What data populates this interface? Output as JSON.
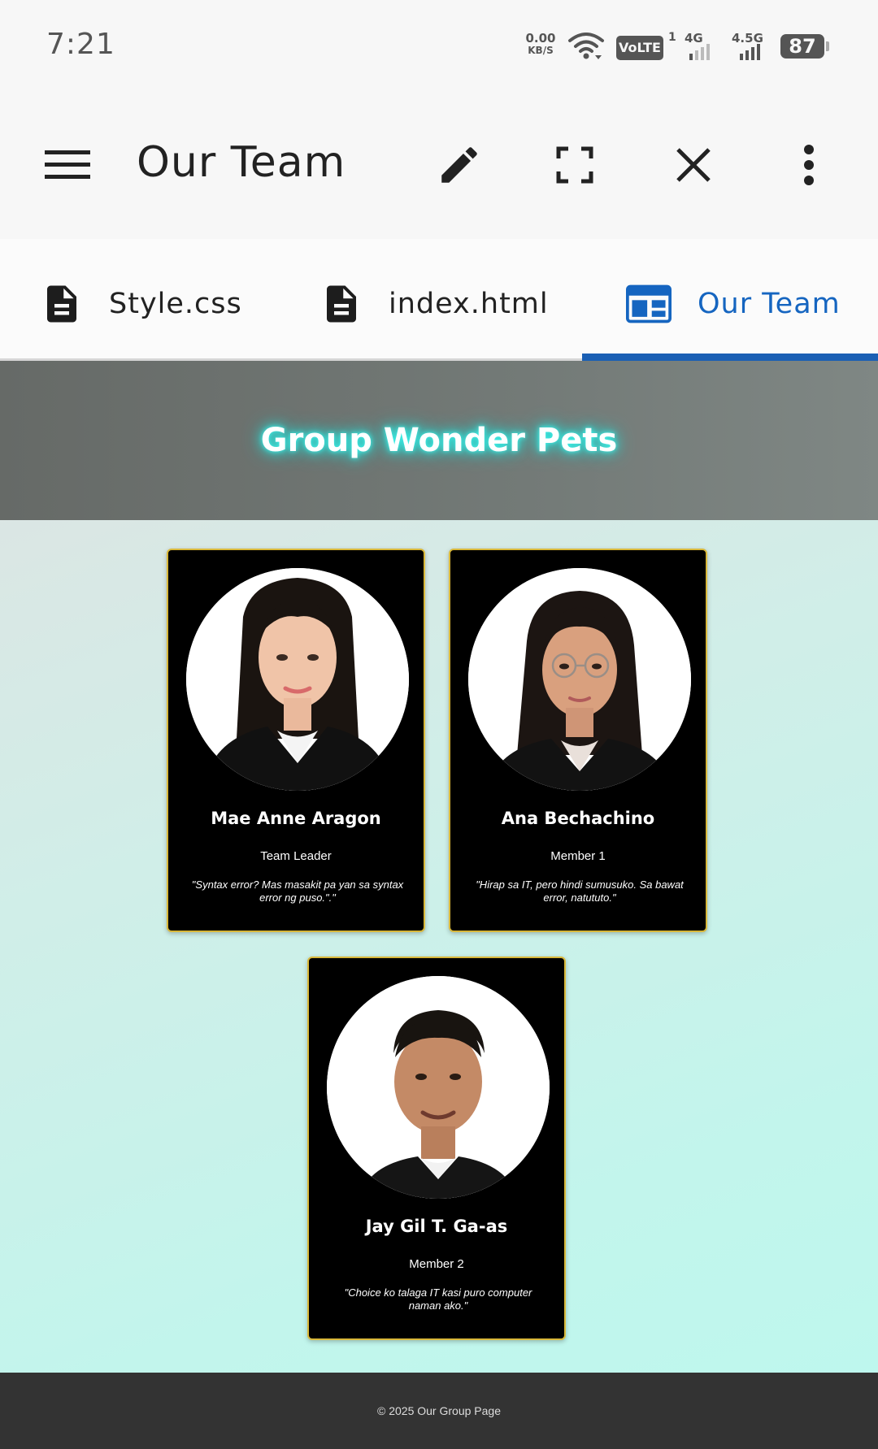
{
  "status_bar": {
    "time": "7:21",
    "data_speed_value": "0.00",
    "data_speed_unit": "KB/S",
    "volte_label": "VoLTE",
    "volte_sim": "1",
    "network_1": "4G",
    "network_2": "4.5G",
    "battery_level": "87"
  },
  "app_bar": {
    "title": "Our Team",
    "icons": [
      "menu-icon",
      "edit-icon",
      "fullscreen-icon",
      "close-icon",
      "more-vert-icon"
    ]
  },
  "tabs": [
    {
      "label": "Style.css",
      "icon": "document-icon",
      "active": false
    },
    {
      "label": "index.html",
      "icon": "document-icon",
      "active": false
    },
    {
      "label": "Our Team",
      "icon": "web-preview-icon",
      "active": true
    }
  ],
  "colors": {
    "accent_blue": "#1565c0",
    "tab_indicator": "#1a5fb4",
    "title_glow": "#2ee8e0",
    "card_border": "#d9b83a",
    "card_bg": "#000000",
    "footer_bg": "#333333"
  },
  "page": {
    "header_title": "Group Wonder Pets",
    "members": [
      {
        "name": "Mae Anne Aragon",
        "role": "Team Leader",
        "quote": "\"Syntax error? Mas masakit pa yan sa syntax error ng puso.\".\""
      },
      {
        "name": "Ana Bechachino",
        "role": "Member 1",
        "quote": "\"Hirap sa IT, pero hindi sumusuko. Sa bawat error, natututo.\""
      },
      {
        "name": "Jay Gil T. Ga-as",
        "role": "Member 2",
        "quote": "\"Choice ko talaga IT kasi puro computer naman ako.\""
      }
    ],
    "footer": "© 2025 Our Group Page"
  }
}
